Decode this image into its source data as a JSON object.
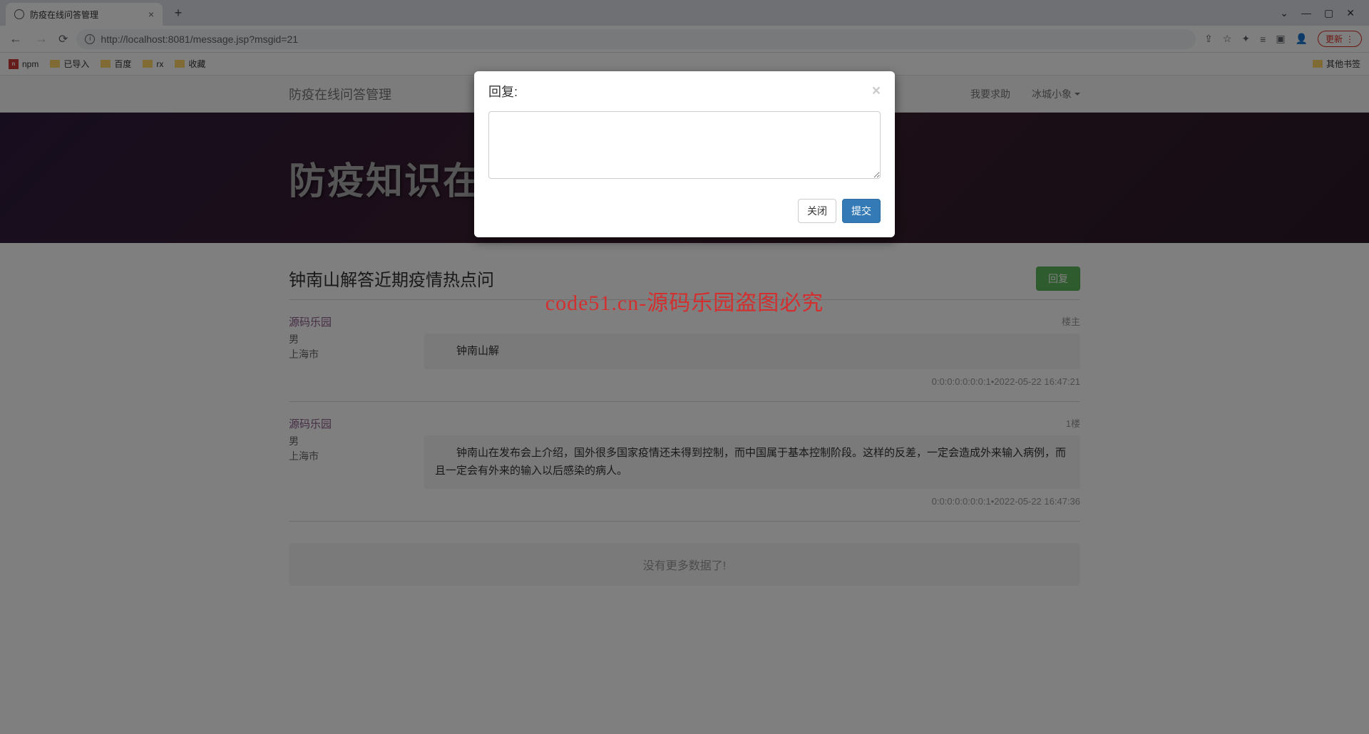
{
  "browser": {
    "tab_title": "防疫在线问答管理",
    "url_display": "http://localhost:8081/message.jsp?msgid=21",
    "update_label": "更新",
    "bookmarks": [
      {
        "label": "npm",
        "type": "npm"
      },
      {
        "label": "已导入",
        "type": "folder"
      },
      {
        "label": "百度",
        "type": "folder"
      },
      {
        "label": "rx",
        "type": "folder"
      },
      {
        "label": "收藏",
        "type": "folder"
      }
    ],
    "other_bookmarks": "其他书签"
  },
  "navbar": {
    "brand": "防疫在线问答管理",
    "help_link": "我要求助",
    "user_name": "冰城小象"
  },
  "hero": {
    "title": "防疫知识在"
  },
  "thread": {
    "title": "钟南山解答近期疫情热点问",
    "reply_button": "回复"
  },
  "posts": [
    {
      "user_name": "源码乐园",
      "gender": "男",
      "city": "上海市",
      "floor": "楼主",
      "content": "钟南山解",
      "footer": "0:0:0:0:0:0:0:1•2022-05-22 16:47:21"
    },
    {
      "user_name": "源码乐园",
      "gender": "男",
      "city": "上海市",
      "floor": "1楼",
      "content": "钟南山在发布会上介绍，国外很多国家疫情还未得到控制，而中国属于基本控制阶段。这样的反差，一定会造成外来输入病例，而且一定会有外来的输入以后感染的病人。",
      "footer": "0:0:0:0:0:0:0:1•2022-05-22 16:47:36"
    }
  ],
  "no_more": "没有更多数据了!",
  "modal": {
    "title": "回复:",
    "close_label": "关闭",
    "submit_label": "提交"
  },
  "watermark": "code51.cn-源码乐园盗图必究"
}
